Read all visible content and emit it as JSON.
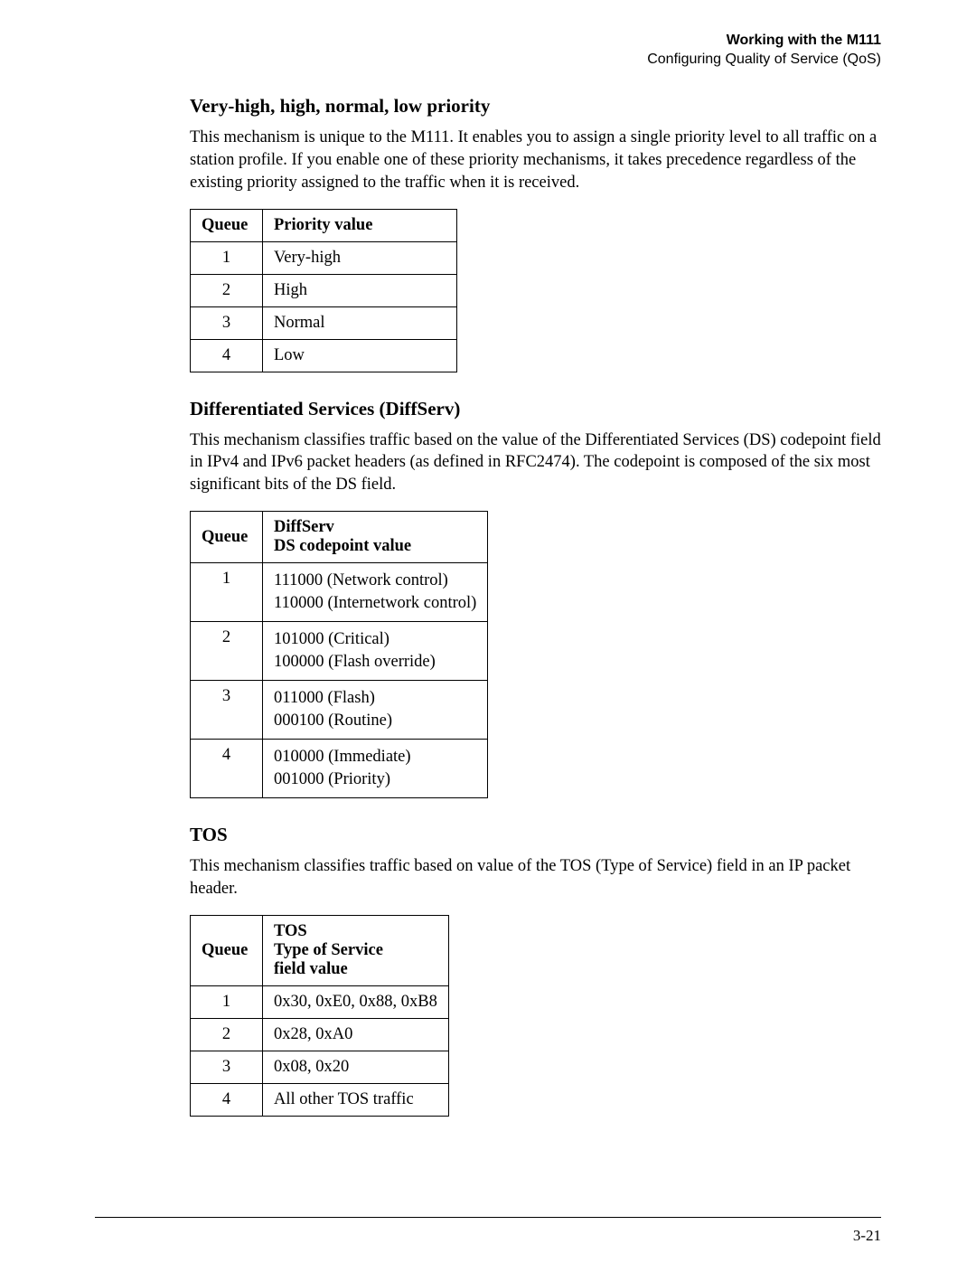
{
  "header": {
    "line1": "Working with the M111",
    "line2": "Configuring Quality of Service (QoS)"
  },
  "sections": {
    "priority": {
      "heading": "Very-high, high, normal, low priority",
      "paragraph": "This mechanism is unique to the M111. It enables you to assign a single priority level to all traffic on a station profile. If you enable one of these priority mechanisms, it takes precedence regardless of the existing priority assigned to the traffic when it is received.",
      "table": {
        "headers": {
          "col1": "Queue",
          "col2": "Priority value"
        },
        "rows": [
          {
            "queue": "1",
            "value": "Very-high"
          },
          {
            "queue": "2",
            "value": "High"
          },
          {
            "queue": "3",
            "value": "Normal"
          },
          {
            "queue": "4",
            "value": "Low"
          }
        ]
      }
    },
    "diffserv": {
      "heading": "Differentiated Services (DiffServ)",
      "paragraph": "This mechanism classifies traffic based on the value of the Differentiated Services (DS) codepoint field in IPv4 and IPv6 packet headers (as defined in RFC2474). The codepoint is composed of the six most significant bits of the DS field.",
      "table": {
        "headers": {
          "col1": "Queue",
          "col2a": "DiffServ",
          "col2b": "DS codepoint value"
        },
        "rows": [
          {
            "queue": "1",
            "line1": "111000 (Network control)",
            "line2": "110000 (Internetwork control)"
          },
          {
            "queue": "2",
            "line1": "101000 (Critical)",
            "line2": "100000 (Flash override)"
          },
          {
            "queue": "3",
            "line1": "011000 (Flash)",
            "line2": "000100 (Routine)"
          },
          {
            "queue": "4",
            "line1": "010000 (Immediate)",
            "line2": "001000 (Priority)"
          }
        ]
      }
    },
    "tos": {
      "heading": "TOS",
      "paragraph": "This mechanism classifies traffic based on value of the TOS (Type of Service) field in an IP packet header.",
      "table": {
        "headers": {
          "col1": "Queue",
          "col2a": "TOS",
          "col2b": "Type of Service",
          "col2c": "field value"
        },
        "rows": [
          {
            "queue": "1",
            "value": "0x30, 0xE0, 0x88, 0xB8"
          },
          {
            "queue": "2",
            "value": "0x28, 0xA0"
          },
          {
            "queue": "3",
            "value": "0x08, 0x20"
          },
          {
            "queue": "4",
            "value": "All other TOS traffic"
          }
        ]
      }
    }
  },
  "footer": {
    "page_number": "3-21"
  }
}
